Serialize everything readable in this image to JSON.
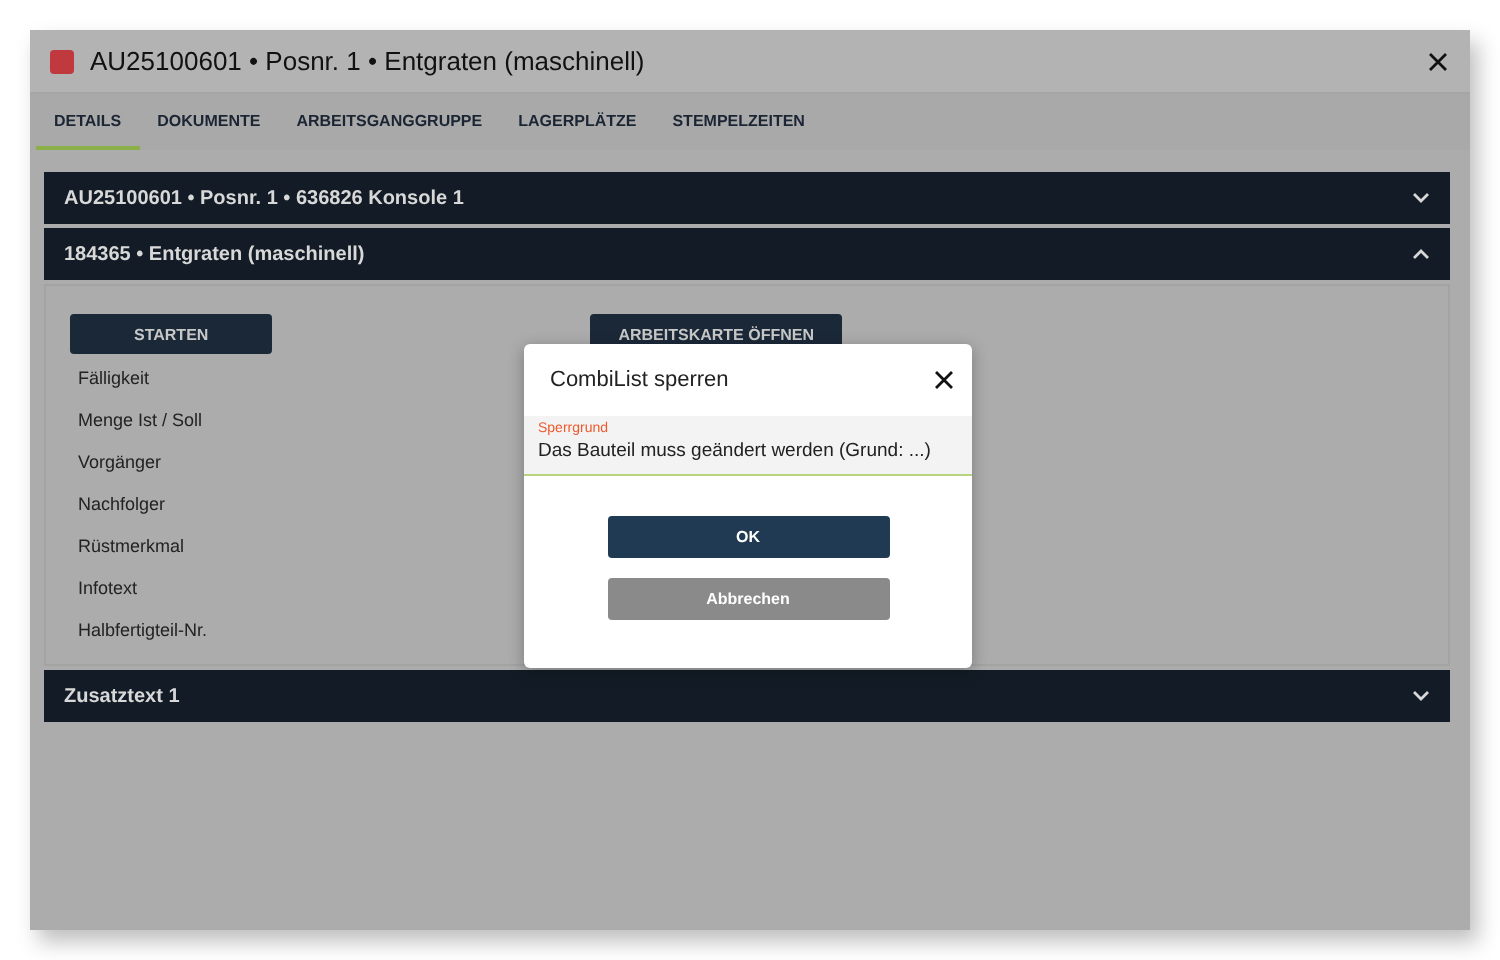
{
  "window": {
    "title": "AU25100601 • Posnr. 1 • Entgraten (maschinell)"
  },
  "tabs": [
    {
      "label": "DETAILS",
      "selected": true
    },
    {
      "label": "DOKUMENTE",
      "selected": false
    },
    {
      "label": "ARBEITSGANGGRUPPE",
      "selected": false
    },
    {
      "label": "LAGERPLÄTZE",
      "selected": false
    },
    {
      "label": "STEMPELZEITEN",
      "selected": false
    }
  ],
  "sections": [
    {
      "title": "AU25100601 • Posnr. 1 • 636826 Konsole 1",
      "expanded": false
    },
    {
      "title": "184365 • Entgraten (maschinell)",
      "expanded": true,
      "buttons": [
        "STARTEN",
        "ARBEITSKARTE ÖFFNEN"
      ],
      "fields": [
        "Fälligkeit",
        "Menge Ist / Soll",
        "Vorgänger",
        "Nachfolger",
        "Rüstmerkmal",
        "Infotext",
        "Halbfertigteil-Nr."
      ]
    },
    {
      "title": "Zusatztext 1",
      "expanded": false
    }
  ],
  "dialog": {
    "title": "CombiList sperren",
    "field": {
      "label": "Sperrgrund",
      "value": "Das Bauteil muss geändert werden (Grund: ...)"
    },
    "buttons": [
      {
        "label": "OK",
        "kind": "primary"
      },
      {
        "label": "Abbrechen",
        "kind": "secondary"
      }
    ]
  }
}
